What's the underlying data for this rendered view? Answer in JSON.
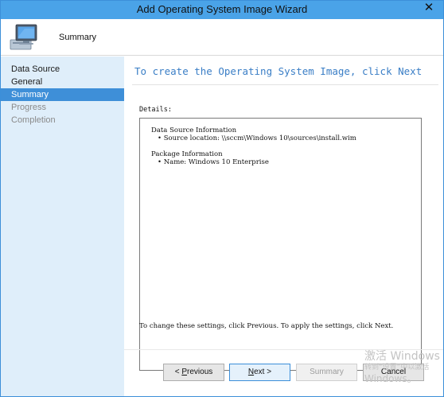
{
  "window": {
    "title": "Add Operating System Image Wizard",
    "close_glyph": "✕"
  },
  "header": {
    "page_title": "Summary",
    "icon": "computer-icon"
  },
  "nav": {
    "items": [
      {
        "label": "Data Source",
        "state": "done"
      },
      {
        "label": "General",
        "state": "done"
      },
      {
        "label": "Summary",
        "state": "current"
      },
      {
        "label": "Progress",
        "state": "future"
      },
      {
        "label": "Completion",
        "state": "future"
      }
    ]
  },
  "content": {
    "heading": "To create the Operating System Image, click Next",
    "details_label": "Details:",
    "details": {
      "group1_title": "Data Source Information",
      "group1_item1": "• Source location: \\\\sccm\\Windows 10\\sources\\install.wim",
      "group2_title": "Package Information",
      "group2_item1": "• Name: Windows 10 Enterprise"
    },
    "hint": "To change these settings, click Previous. To apply the settings, click Next."
  },
  "buttons": {
    "previous_prefix": "< ",
    "previous_key": "P",
    "previous_rest": "revious",
    "next_key": "N",
    "next_rest": "ext >",
    "summary": "Summary",
    "cancel": "Cancel"
  },
  "watermark": {
    "line1": "激活 Windows",
    "line2": "转到“设置”中以激活",
    "line3": "Windows。"
  },
  "colors": {
    "titlebar": "#4aa3e8",
    "nav_bg": "#dfeefa",
    "nav_selected": "#3e8fd8",
    "heading": "#3a7ec6"
  }
}
